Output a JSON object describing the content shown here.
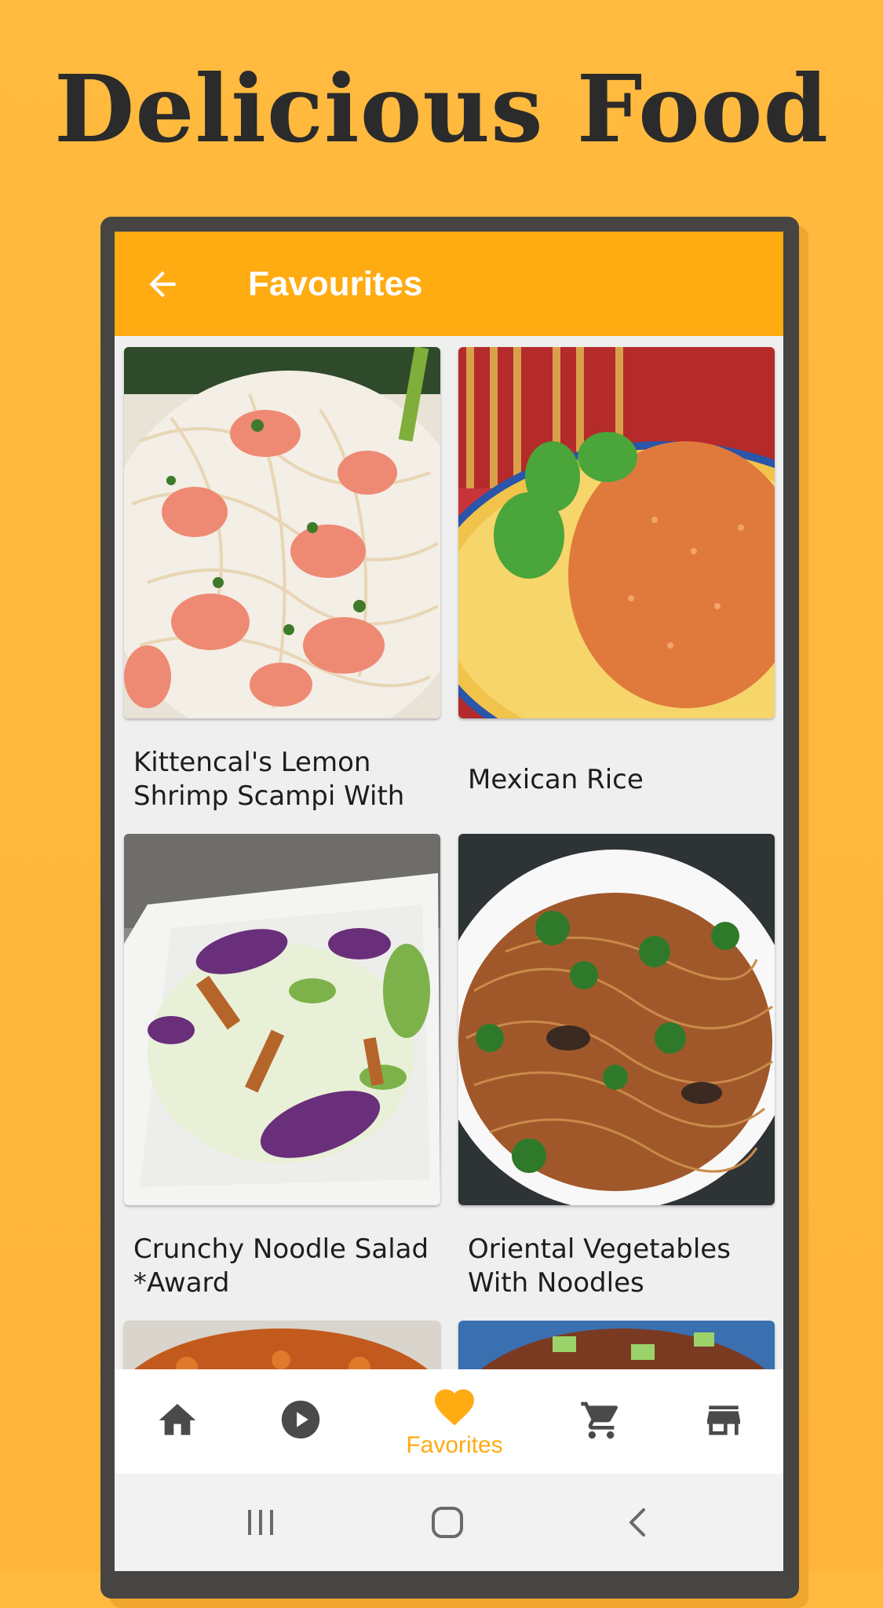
{
  "promo": {
    "headline": "Delicious Food"
  },
  "appbar": {
    "title": "Favourites",
    "back_icon": "arrow-left-icon"
  },
  "favorites": [
    {
      "title": "Kittencal's Lemon Shrimp Scampi With",
      "image": "shrimp-pasta"
    },
    {
      "title": "Mexican Rice",
      "image": "mexican-rice"
    },
    {
      "title": "Crunchy Noodle Salad  *Award",
      "image": "noodle-salad"
    },
    {
      "title": "Oriental Vegetables With Noodles",
      "image": "oriental-noodles"
    }
  ],
  "bottom_nav": {
    "items": [
      {
        "icon": "home-icon",
        "label": ""
      },
      {
        "icon": "play-circle-icon",
        "label": ""
      },
      {
        "icon": "heart-icon",
        "label": "Favorites",
        "active": true
      },
      {
        "icon": "cart-icon",
        "label": ""
      },
      {
        "icon": "store-icon",
        "label": ""
      }
    ]
  },
  "colors": {
    "background": "#ffb43a",
    "appbar": "#ffab12",
    "active_nav": "#ffab12",
    "inactive_nav": "#4a4a4a",
    "frame": "#464543"
  }
}
